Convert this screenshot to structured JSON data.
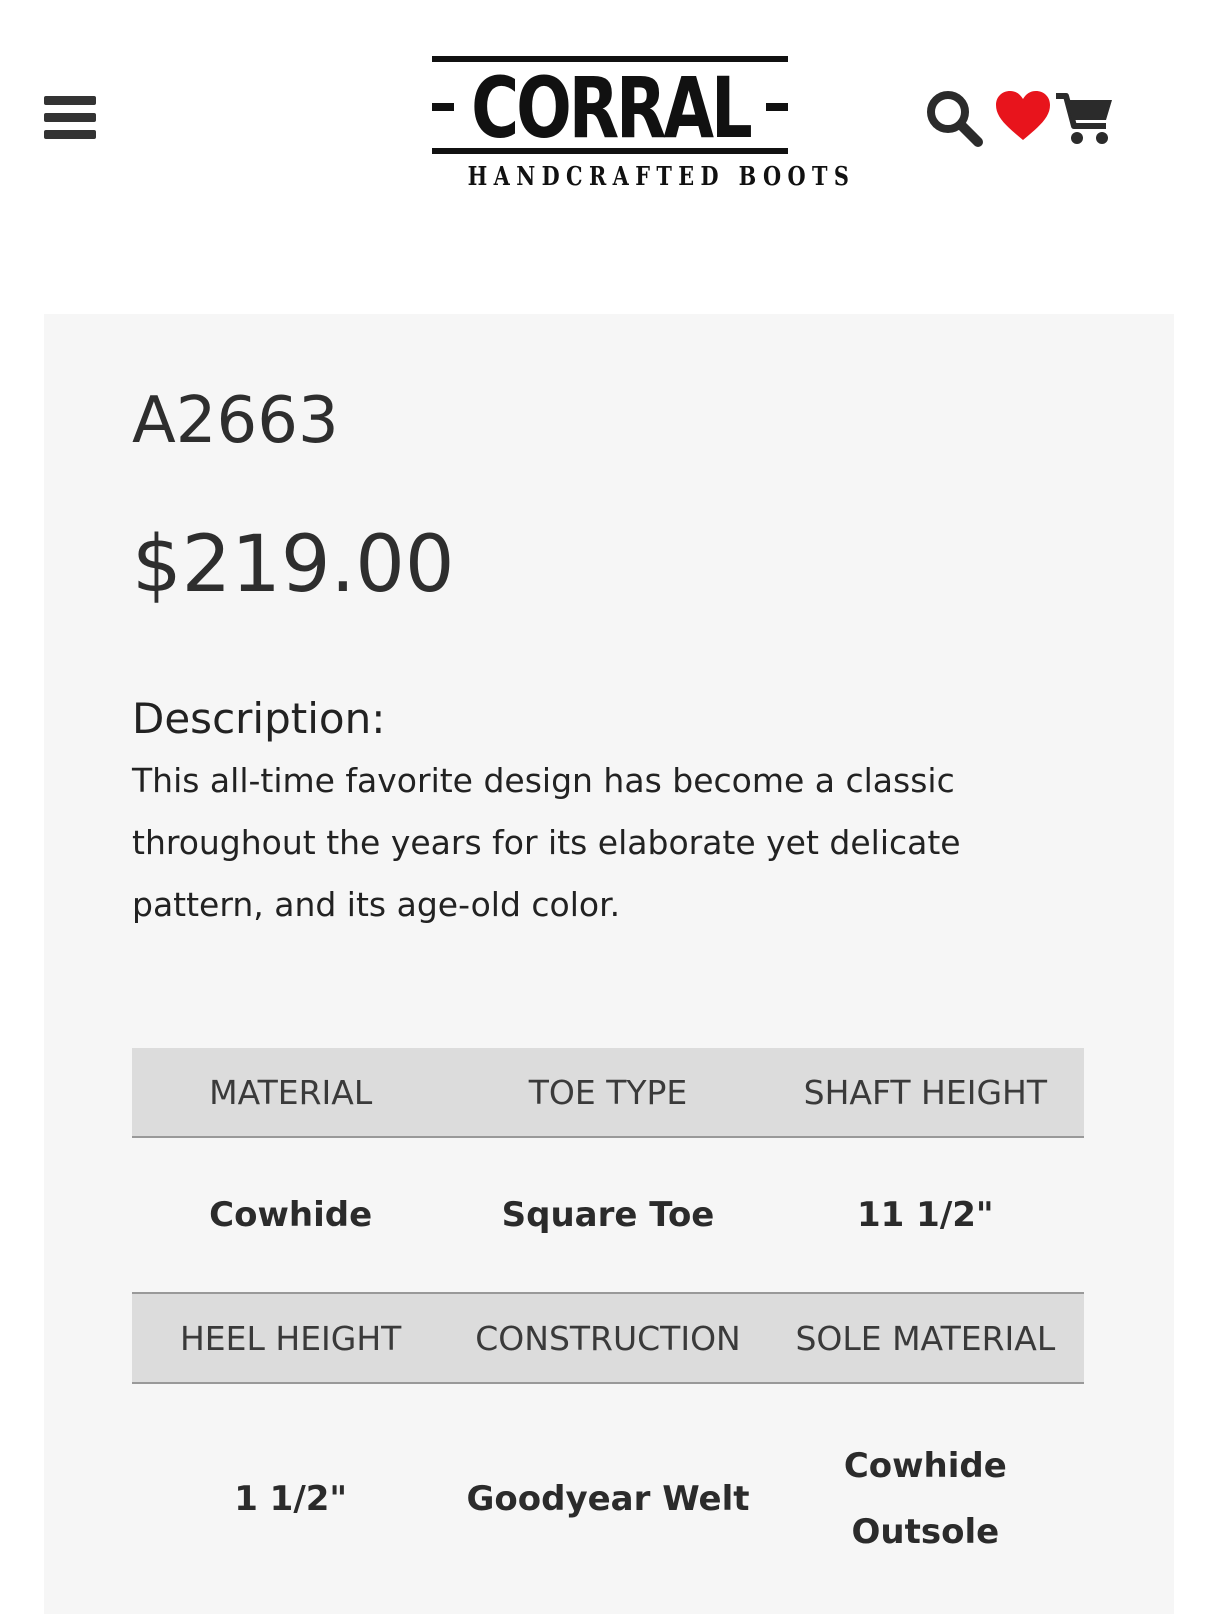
{
  "header": {
    "logo_word": "CORRAL",
    "logo_tagline": "HANDCRAFTED BOOTS",
    "icons": [
      "menu-icon",
      "search-icon",
      "heart-icon",
      "cart-icon"
    ],
    "heart_color": "#e8141c"
  },
  "product": {
    "sku": "A2663",
    "price": "$219.00",
    "description_heading": "Description:",
    "description": "This all-time favorite design has become a classic throughout the years for its elaborate yet delicate pattern, and its age-old color."
  },
  "specs": {
    "row1": {
      "headers": [
        "MATERIAL",
        "TOE TYPE",
        "SHAFT HEIGHT"
      ],
      "values": [
        "Cowhide",
        "Square Toe",
        "11 1/2\""
      ]
    },
    "row2": {
      "headers": [
        "HEEL HEIGHT",
        "CONSTRUCTION",
        "SOLE MATERIAL"
      ],
      "values": [
        "1 1/2\"",
        "Goodyear Welt",
        "Cowhide Outsole"
      ]
    }
  }
}
